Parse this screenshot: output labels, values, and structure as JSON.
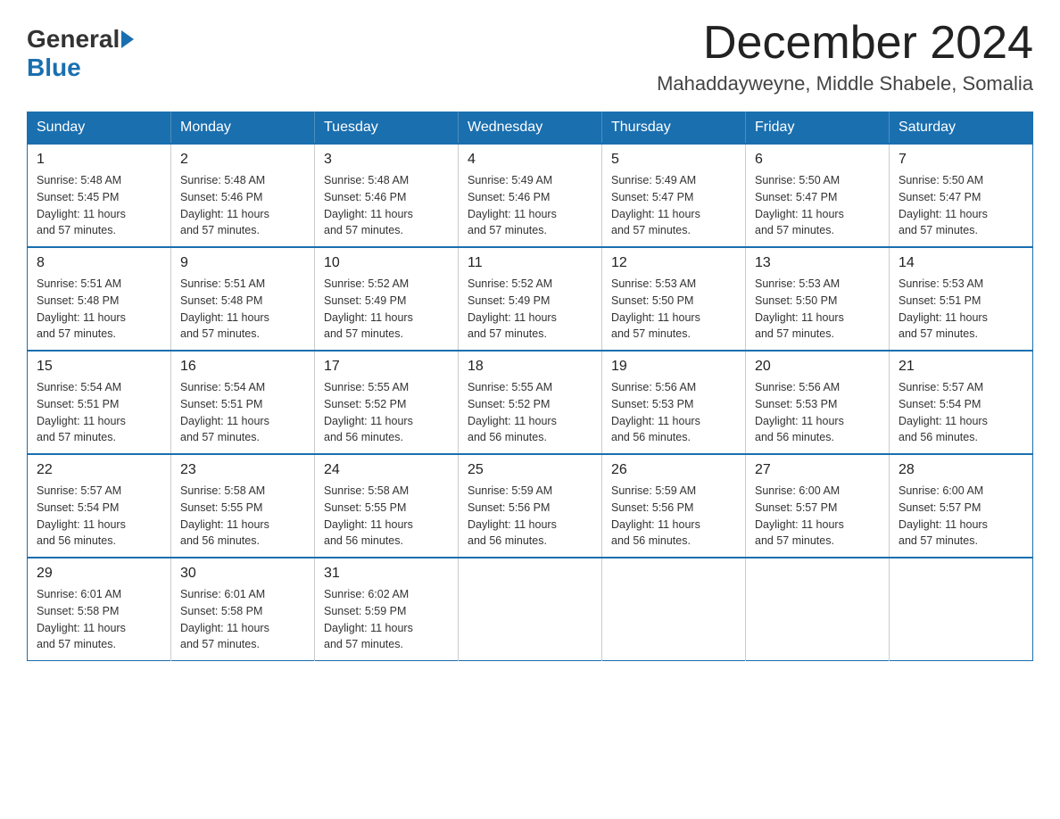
{
  "logo": {
    "text_general": "General",
    "text_blue": "Blue"
  },
  "title": "December 2024",
  "subtitle": "Mahaddayweyne, Middle Shabele, Somalia",
  "days_of_week": [
    "Sunday",
    "Monday",
    "Tuesday",
    "Wednesday",
    "Thursday",
    "Friday",
    "Saturday"
  ],
  "weeks": [
    [
      {
        "day": "1",
        "sunrise": "5:48 AM",
        "sunset": "5:45 PM",
        "daylight": "11 hours and 57 minutes."
      },
      {
        "day": "2",
        "sunrise": "5:48 AM",
        "sunset": "5:46 PM",
        "daylight": "11 hours and 57 minutes."
      },
      {
        "day": "3",
        "sunrise": "5:48 AM",
        "sunset": "5:46 PM",
        "daylight": "11 hours and 57 minutes."
      },
      {
        "day": "4",
        "sunrise": "5:49 AM",
        "sunset": "5:46 PM",
        "daylight": "11 hours and 57 minutes."
      },
      {
        "day": "5",
        "sunrise": "5:49 AM",
        "sunset": "5:47 PM",
        "daylight": "11 hours and 57 minutes."
      },
      {
        "day": "6",
        "sunrise": "5:50 AM",
        "sunset": "5:47 PM",
        "daylight": "11 hours and 57 minutes."
      },
      {
        "day": "7",
        "sunrise": "5:50 AM",
        "sunset": "5:47 PM",
        "daylight": "11 hours and 57 minutes."
      }
    ],
    [
      {
        "day": "8",
        "sunrise": "5:51 AM",
        "sunset": "5:48 PM",
        "daylight": "11 hours and 57 minutes."
      },
      {
        "day": "9",
        "sunrise": "5:51 AM",
        "sunset": "5:48 PM",
        "daylight": "11 hours and 57 minutes."
      },
      {
        "day": "10",
        "sunrise": "5:52 AM",
        "sunset": "5:49 PM",
        "daylight": "11 hours and 57 minutes."
      },
      {
        "day": "11",
        "sunrise": "5:52 AM",
        "sunset": "5:49 PM",
        "daylight": "11 hours and 57 minutes."
      },
      {
        "day": "12",
        "sunrise": "5:53 AM",
        "sunset": "5:50 PM",
        "daylight": "11 hours and 57 minutes."
      },
      {
        "day": "13",
        "sunrise": "5:53 AM",
        "sunset": "5:50 PM",
        "daylight": "11 hours and 57 minutes."
      },
      {
        "day": "14",
        "sunrise": "5:53 AM",
        "sunset": "5:51 PM",
        "daylight": "11 hours and 57 minutes."
      }
    ],
    [
      {
        "day": "15",
        "sunrise": "5:54 AM",
        "sunset": "5:51 PM",
        "daylight": "11 hours and 57 minutes."
      },
      {
        "day": "16",
        "sunrise": "5:54 AM",
        "sunset": "5:51 PM",
        "daylight": "11 hours and 57 minutes."
      },
      {
        "day": "17",
        "sunrise": "5:55 AM",
        "sunset": "5:52 PM",
        "daylight": "11 hours and 56 minutes."
      },
      {
        "day": "18",
        "sunrise": "5:55 AM",
        "sunset": "5:52 PM",
        "daylight": "11 hours and 56 minutes."
      },
      {
        "day": "19",
        "sunrise": "5:56 AM",
        "sunset": "5:53 PM",
        "daylight": "11 hours and 56 minutes."
      },
      {
        "day": "20",
        "sunrise": "5:56 AM",
        "sunset": "5:53 PM",
        "daylight": "11 hours and 56 minutes."
      },
      {
        "day": "21",
        "sunrise": "5:57 AM",
        "sunset": "5:54 PM",
        "daylight": "11 hours and 56 minutes."
      }
    ],
    [
      {
        "day": "22",
        "sunrise": "5:57 AM",
        "sunset": "5:54 PM",
        "daylight": "11 hours and 56 minutes."
      },
      {
        "day": "23",
        "sunrise": "5:58 AM",
        "sunset": "5:55 PM",
        "daylight": "11 hours and 56 minutes."
      },
      {
        "day": "24",
        "sunrise": "5:58 AM",
        "sunset": "5:55 PM",
        "daylight": "11 hours and 56 minutes."
      },
      {
        "day": "25",
        "sunrise": "5:59 AM",
        "sunset": "5:56 PM",
        "daylight": "11 hours and 56 minutes."
      },
      {
        "day": "26",
        "sunrise": "5:59 AM",
        "sunset": "5:56 PM",
        "daylight": "11 hours and 56 minutes."
      },
      {
        "day": "27",
        "sunrise": "6:00 AM",
        "sunset": "5:57 PM",
        "daylight": "11 hours and 57 minutes."
      },
      {
        "day": "28",
        "sunrise": "6:00 AM",
        "sunset": "5:57 PM",
        "daylight": "11 hours and 57 minutes."
      }
    ],
    [
      {
        "day": "29",
        "sunrise": "6:01 AM",
        "sunset": "5:58 PM",
        "daylight": "11 hours and 57 minutes."
      },
      {
        "day": "30",
        "sunrise": "6:01 AM",
        "sunset": "5:58 PM",
        "daylight": "11 hours and 57 minutes."
      },
      {
        "day": "31",
        "sunrise": "6:02 AM",
        "sunset": "5:59 PM",
        "daylight": "11 hours and 57 minutes."
      },
      null,
      null,
      null,
      null
    ]
  ],
  "labels": {
    "sunrise": "Sunrise:",
    "sunset": "Sunset:",
    "daylight": "Daylight:"
  }
}
